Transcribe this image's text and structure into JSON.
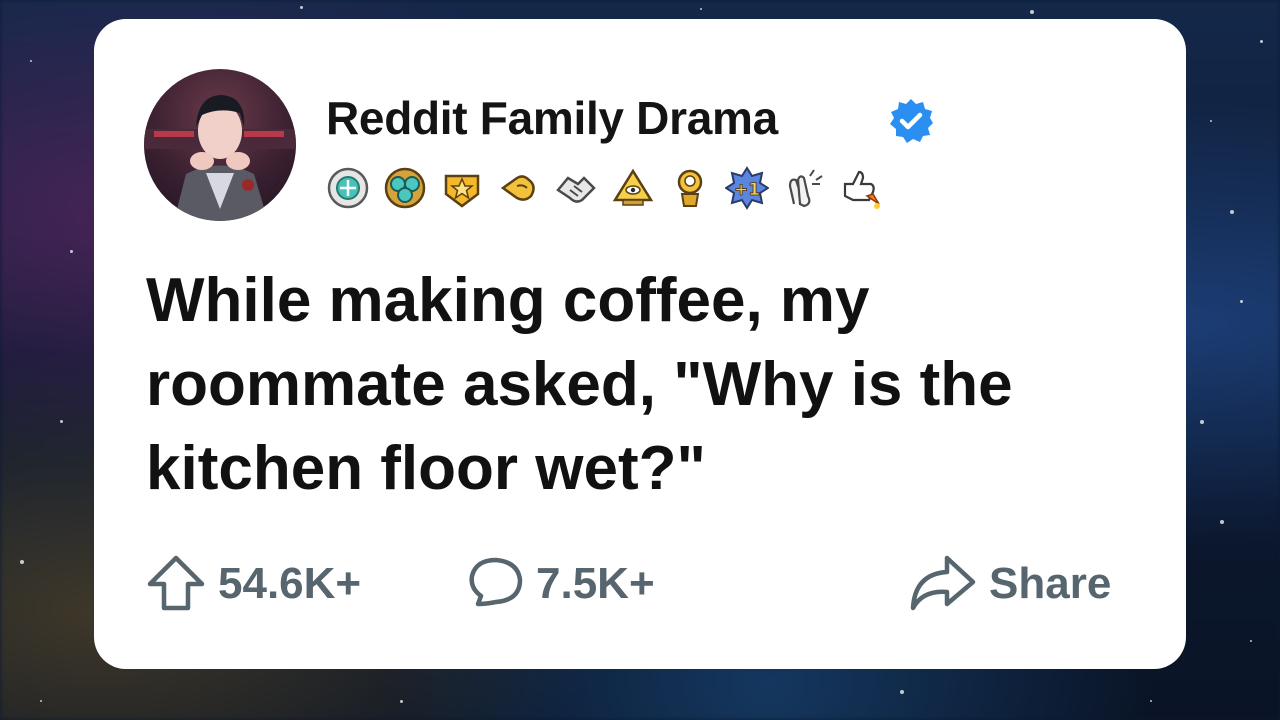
{
  "post": {
    "author": "Reddit Family Drama",
    "verified": true,
    "awards": [
      "medal-award-icon",
      "gem-cluster-award-icon",
      "gold-star-award-icon",
      "pointing-hand-award-icon",
      "handshake-award-icon",
      "pyramid-eye-award-icon",
      "gold-trophy-award-icon",
      "plus-one-award-icon",
      "clapping-hands-award-icon",
      "thumbs-up-rocket-award-icon"
    ],
    "title_lines": [
      "While making coffee, my",
      "roommate asked, \"Why is the",
      "kitchen floor wet?\""
    ]
  },
  "actions": {
    "upvotes": "54.6K+",
    "comments": "7.5K+",
    "share_label": "Share"
  },
  "colors": {
    "card": "#ffffff",
    "title_text": "#111111",
    "action_text": "#56656e",
    "verified_badge": "#2b8ff2"
  }
}
